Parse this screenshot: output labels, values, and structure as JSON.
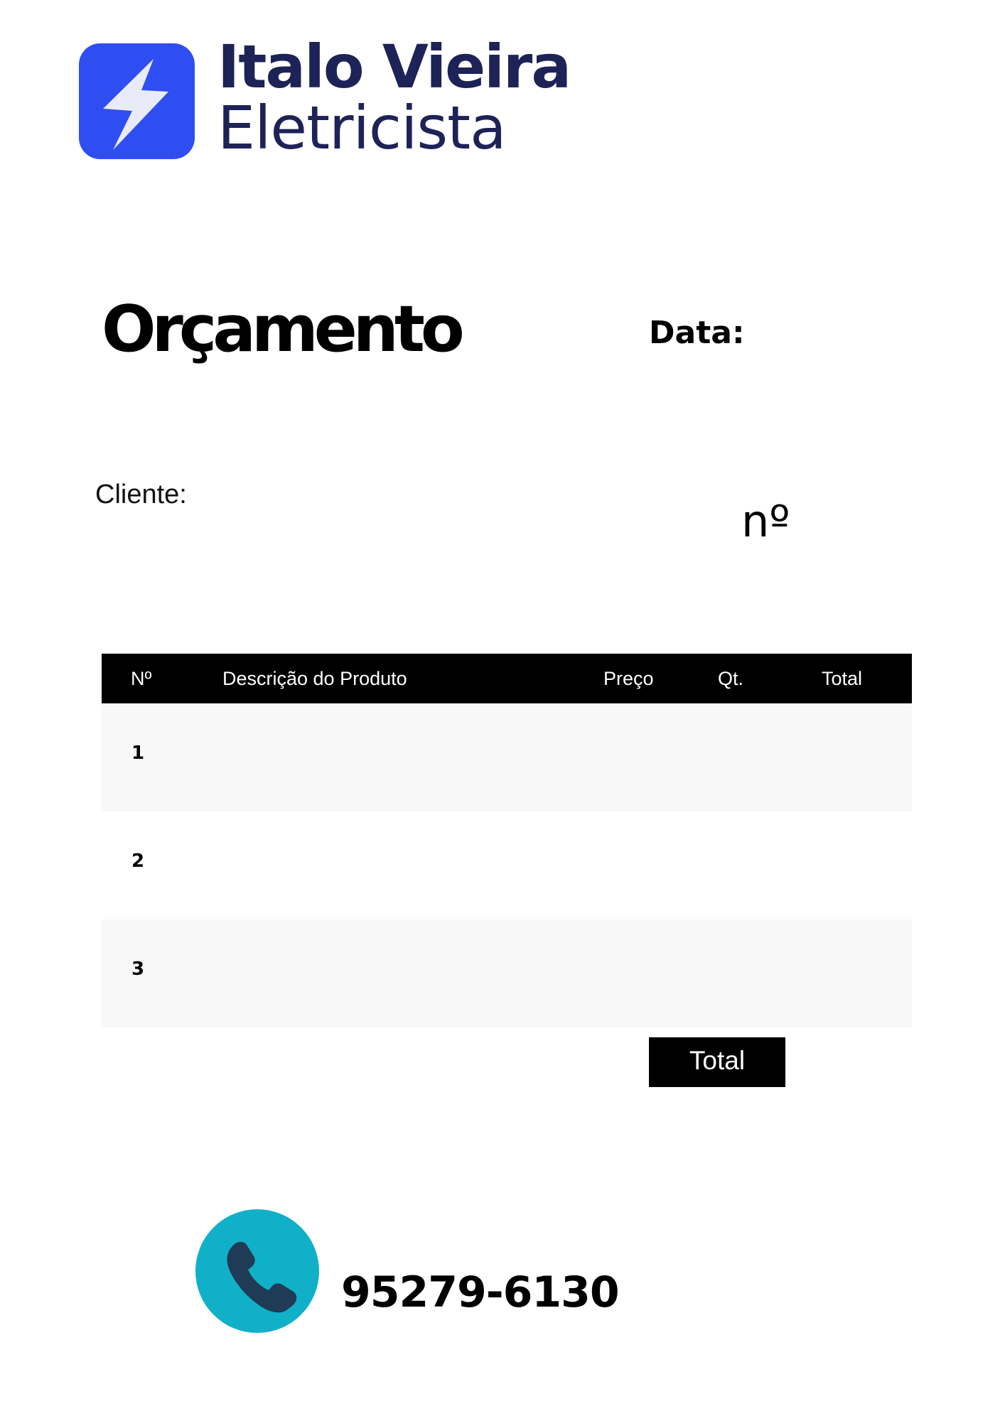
{
  "brand": {
    "name": "Italo Vieira",
    "subtitle": "Eletricista",
    "logo_icon": "lightning-bolt-icon",
    "logo_color": "#2f4ef2",
    "text_color": "#1d2257"
  },
  "document": {
    "title": "Orçamento",
    "date_label": "Data:",
    "client_label": "Cliente:",
    "number_label": "nº"
  },
  "table": {
    "columns": [
      "Nº",
      "Descrição do Produto",
      "Preço",
      "Qt.",
      "Total"
    ],
    "rows": [
      {
        "number": "1"
      },
      {
        "number": "2"
      },
      {
        "number": "3"
      }
    ],
    "header_color": "#000000",
    "shaded_row_color": "#f8f8f8"
  },
  "total_label": "Total",
  "contact": {
    "phone_icon": "phone-icon",
    "phone_icon_bg": "#10b1c8",
    "phone": "95279-6130"
  }
}
